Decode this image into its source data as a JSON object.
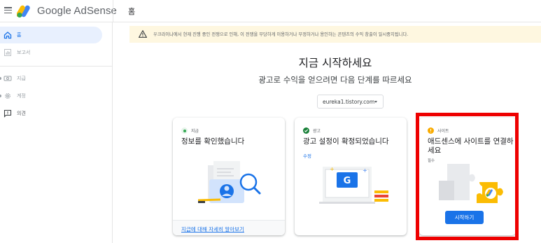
{
  "header": {
    "logo_text": "Google AdSense",
    "page_title": "홈"
  },
  "sidebar": {
    "items": [
      {
        "label": "홈",
        "icon": "home-icon",
        "active": true
      },
      {
        "label": "보고서",
        "icon": "reports-icon",
        "active": false
      },
      {
        "label": "지급",
        "icon": "payments-icon",
        "active": false
      },
      {
        "label": "계정",
        "icon": "gear-icon",
        "active": false
      },
      {
        "label": "의견",
        "icon": "feedback-icon",
        "active": false
      }
    ]
  },
  "alert": {
    "icon": "warning-icon",
    "text": "우크라이나에서 현재 진행 중인 전쟁으로 인해, 이 전쟁을 부당하게 이용하거나 부정하거나 용인하는 콘텐츠의 수익 창출이 일시중지됩니다."
  },
  "main": {
    "heading": "지금 시작하세요",
    "subtitle": "광고로 수익을 얻으려면 다음 단계를 따르세요",
    "site_select": {
      "value": "eureka1.tistory.com"
    }
  },
  "cards": [
    {
      "status": "지급",
      "status_color": "#34a853",
      "title": "정보를 확인했습니다",
      "footer_link": "지급에 대해 자세히 알아보기"
    },
    {
      "status": "광고",
      "status_color": "#188038",
      "title": "광고 설정이 확정되었습니다",
      "link": "수정"
    },
    {
      "status": "사이트",
      "status_color": "#f9ab00",
      "title": "애드센스에 사이트를 연결하세요",
      "required": "필수",
      "button": "시작하기"
    }
  ],
  "colors": {
    "accent": "#1a73e8",
    "highlight": "#ee0000",
    "alert_bg": "#fef7e0"
  }
}
